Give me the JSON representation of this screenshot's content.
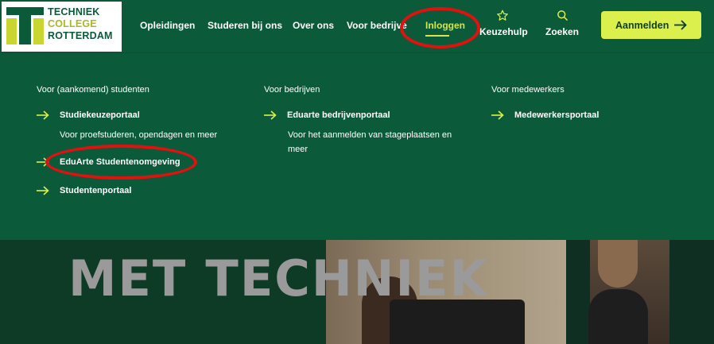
{
  "logo": {
    "line1": "TECHNIEK",
    "line2": "COLLEGE",
    "line3": "ROTTERDAM"
  },
  "nav": [
    {
      "label": "Opleidingen"
    },
    {
      "label": "Studeren bij ons"
    },
    {
      "label": "Over ons"
    },
    {
      "label": "Voor bedrijven"
    },
    {
      "label": "Inloggen",
      "active": true
    }
  ],
  "icon_nav": [
    {
      "label": "Keuzehulp",
      "icon": "star-icon"
    },
    {
      "label": "Zoeken",
      "icon": "search-icon"
    }
  ],
  "cta": {
    "label": "Aanmelden",
    "icon": "arrow-right-icon"
  },
  "dropdown": {
    "students": {
      "title": "Voor (aankomend) studenten",
      "links": [
        {
          "label": "Studiekeuzeportaal",
          "description": "Voor proefstuderen, opendagen en meer"
        },
        {
          "label": "EduArte Studentenomgeving"
        },
        {
          "label": "Studentenportaal"
        }
      ]
    },
    "companies": {
      "title": "Voor bedrijven",
      "links": [
        {
          "label": "Eduarte bedrijvenportaal",
          "description": "Voor het aanmelden van stageplaatsen en meer"
        }
      ]
    },
    "employees": {
      "title": "Voor medewerkers",
      "links": [
        {
          "label": "Medewerkersportaal"
        }
      ]
    }
  },
  "hero": {
    "headline": "MET TECHNIEK"
  },
  "colors": {
    "brand_green": "#0b5a3a",
    "accent_lime": "#dcf04d",
    "annotation_red": "#e31010"
  }
}
